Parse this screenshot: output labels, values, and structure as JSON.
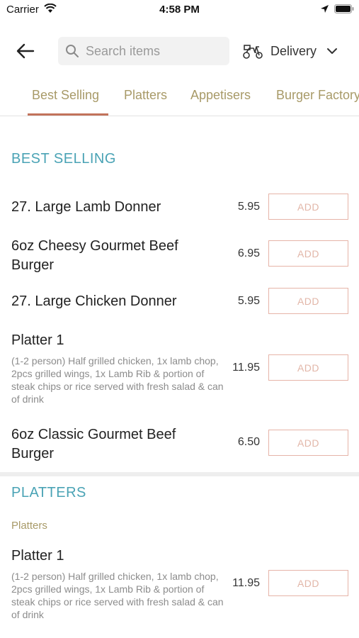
{
  "status_bar": {
    "carrier": "Carrier",
    "time": "4:58 PM"
  },
  "header": {
    "search_placeholder": "Search items",
    "delivery_label": "Delivery"
  },
  "tabs": [
    {
      "label": "Best Selling",
      "active": true
    },
    {
      "label": "Platters"
    },
    {
      "label": "Appetisers"
    },
    {
      "label": "Burger Factory"
    }
  ],
  "sections": [
    {
      "title": "BEST SELLING",
      "items": [
        {
          "name": "27. Large Lamb Donner",
          "price": "5.95",
          "add_label": "ADD"
        },
        {
          "name": "6oz Cheesy Gourmet Beef Burger",
          "price": "6.95",
          "add_label": "ADD"
        },
        {
          "name": "27. Large Chicken Donner",
          "price": "5.95",
          "add_label": "ADD"
        },
        {
          "name": "Platter 1",
          "description": "(1-2 person) Half grilled chicken, 1x lamb chop, 2pcs grilled wings, 1x Lamb Rib & portion of steak chips or rice served with fresh salad & can of drink",
          "price": "11.95",
          "add_label": "ADD"
        },
        {
          "name": "6oz Classic Gourmet Beef Burger",
          "price": "6.50",
          "add_label": "ADD"
        }
      ]
    },
    {
      "title": "PLATTERS",
      "subtitle": "Platters",
      "items": [
        {
          "name": "Platter 1",
          "description": "(1-2 person) Half grilled chicken, 1x lamb chop, 2pcs grilled wings, 1x Lamb Rib & portion of steak chips or rice served with fresh salad & can of drink",
          "price": "11.95",
          "add_label": "ADD"
        }
      ]
    }
  ],
  "colors": {
    "section_title": "#4aa3b5",
    "tab_text": "#a89a68",
    "tab_active_underline": "#c2735b",
    "add_button_border": "#e6b4a8"
  }
}
